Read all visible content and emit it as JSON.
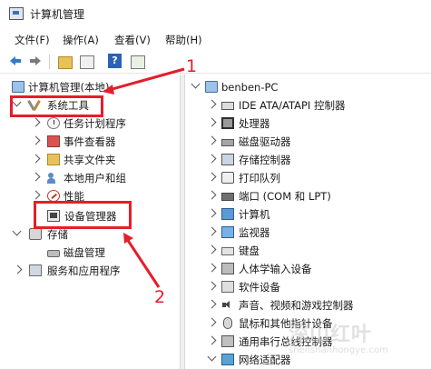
{
  "window": {
    "title": "计算机管理"
  },
  "menu": [
    "文件(F)",
    "操作(A)",
    "查看(V)",
    "帮助(H)"
  ],
  "toolbar": {
    "icons": [
      "back-arrow-icon",
      "forward-arrow-icon",
      "up-folder-icon",
      "show-hide-tree-icon",
      "help-icon",
      "properties-icon"
    ]
  },
  "left_tree": {
    "root": "计算机管理(本地)",
    "system_tools": "系统工具",
    "task_scheduler": "任务计划程序",
    "event_viewer": "事件查看器",
    "shared_folders": "共享文件夹",
    "local_users": "本地用户和组",
    "performance": "性能",
    "device_manager": "设备管理器",
    "storage": "存储",
    "disk_management": "磁盘管理",
    "services_apps": "服务和应用程序"
  },
  "device_list": {
    "host": "benben-PC",
    "items": [
      "IDE ATA/ATAPI 控制器",
      "处理器",
      "磁盘驱动器",
      "存储控制器",
      "打印队列",
      "端口 (COM 和 LPT)",
      "计算机",
      "监视器",
      "键盘",
      "人体学输入设备",
      "软件设备",
      "声音、视频和游戏控制器",
      "鼠标和其他指针设备",
      "通用串行总线控制器",
      "网络适配器"
    ]
  },
  "annotations": {
    "step1": "1",
    "step2": "2"
  },
  "watermark": {
    "text": "深山红叶",
    "url": "shenshanhongye.com"
  }
}
